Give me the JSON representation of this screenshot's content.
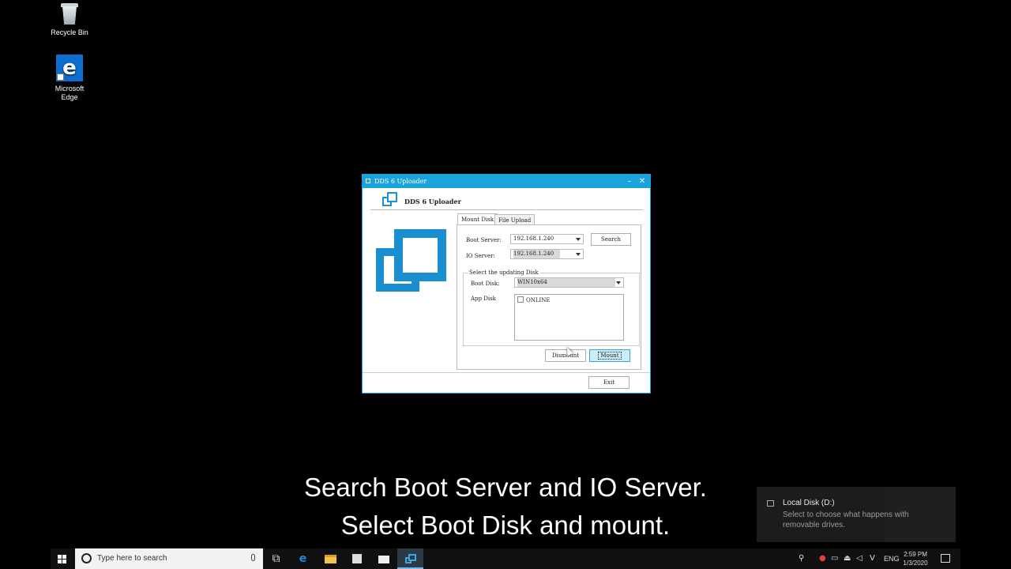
{
  "desktop": {
    "icons": [
      {
        "label": "Recycle Bin",
        "icon": "recycle-bin-icon"
      },
      {
        "label": "Microsoft Edge",
        "icon": "edge-icon"
      }
    ]
  },
  "window": {
    "title": "DDS 6 Uploader",
    "heading": "DDS 6 Uploader",
    "tabs": [
      {
        "label": "Mount Disk",
        "active": true
      },
      {
        "label": "File Upload",
        "active": false
      }
    ],
    "boot_server": {
      "label": "Boot Server:",
      "value": "192.168.1.240"
    },
    "io_server": {
      "label": "IO Server:",
      "value": "192.168.1.240"
    },
    "search_label": "Search",
    "group_title": "Select the updating Disk",
    "boot_disk": {
      "label": "Boot Disk:",
      "value": "WIN10x64"
    },
    "app_disk": {
      "label": "App Disk",
      "items": [
        {
          "label": "ONLINE",
          "checked": false
        }
      ]
    },
    "dismount_label": "Dismount",
    "mount_label": "Mount",
    "exit_label": "Exit",
    "accent_color": "#1ba3dc"
  },
  "subtitles": {
    "line1": "Search Boot Server and IO Server.",
    "line2": "Select Boot Disk and mount."
  },
  "toast": {
    "title": "Local Disk (D:)",
    "body": "Select to choose what happens with removable drives."
  },
  "taskbar": {
    "search_placeholder": "Type here to search",
    "language": "ENG",
    "time": "2:59 PM",
    "date": "1/3/2020"
  }
}
